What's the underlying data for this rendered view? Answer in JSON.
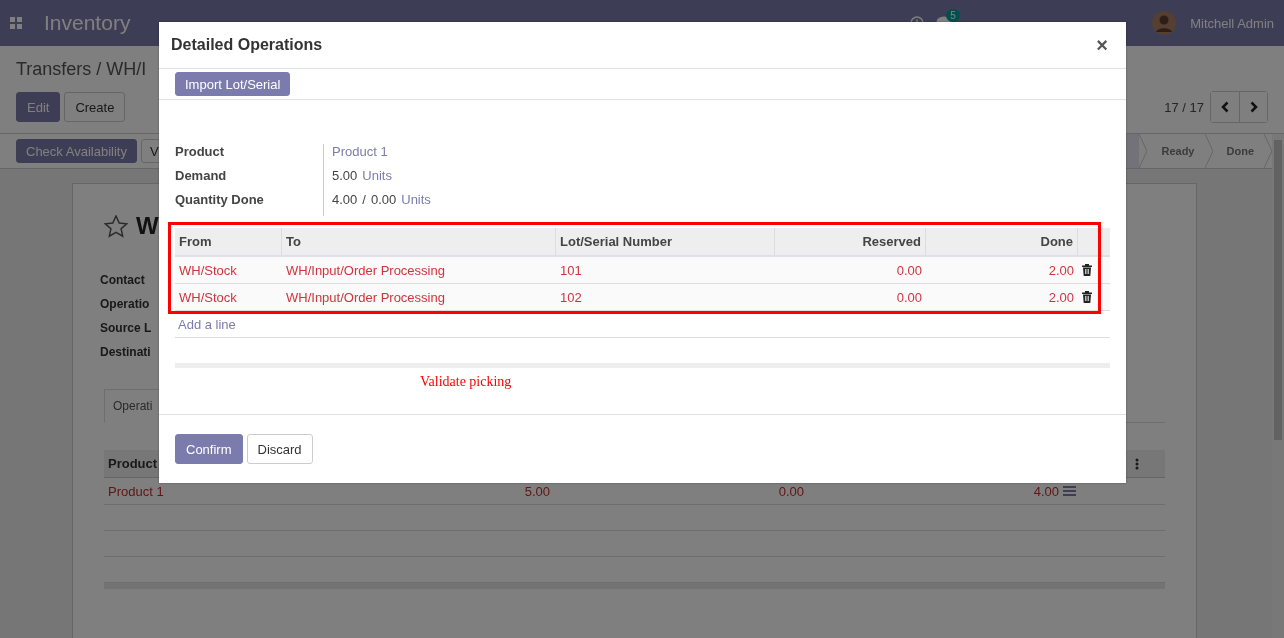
{
  "navbar": {
    "app_name": "Inventory",
    "notification_count": "5",
    "user": "Mitchell Admin"
  },
  "control_panel": {
    "breadcrumb": "Transfers / WH/I",
    "buttons": [
      {
        "label": "Edit",
        "kind": "primary"
      },
      {
        "label": "Create",
        "kind": "secondary"
      }
    ],
    "pager": "17 / 17"
  },
  "status_bar": {
    "buttons": [
      {
        "label": "Check Availability",
        "kind": "primary"
      },
      {
        "label": "V",
        "kind": "secondary"
      }
    ],
    "stages": [
      {
        "selected": true
      },
      {
        "label": "Ready",
        "selected": false
      },
      {
        "label": "Done",
        "selected": false
      }
    ]
  },
  "form": {
    "title": "W",
    "fields": [
      "Contact",
      "Operatio",
      "Source L",
      "Destinati"
    ],
    "tabs": [
      {
        "label": "Operati",
        "selected": true
      }
    ],
    "table": {
      "columns": [
        "Product"
      ],
      "rows": [
        {
          "product": "Product 1",
          "column_2": "5.00",
          "column_3": "0.00",
          "column_4": "4.00"
        }
      ]
    }
  },
  "dialog": {
    "title": "Detailed Operations",
    "close": "×",
    "header_button": "Import Lot/Serial",
    "fields": [
      {
        "label": "Product",
        "parts": [
          {
            "text": "Product 1",
            "kind": "link"
          }
        ]
      },
      {
        "label": "Demand",
        "parts": [
          {
            "text": "5.00",
            "kind": "plain"
          },
          {
            "text": "Units",
            "kind": "link"
          }
        ]
      },
      {
        "label": "Quantity Done",
        "parts": [
          {
            "text": "4.00",
            "kind": "plain"
          },
          {
            "text": "/",
            "kind": "plain"
          },
          {
            "text": "0.00",
            "kind": "plain"
          },
          {
            "text": "Units",
            "kind": "link"
          }
        ]
      }
    ],
    "table": {
      "columns": [
        {
          "label": "From",
          "numeric": false
        },
        {
          "label": "To",
          "numeric": false
        },
        {
          "label": "Lot/Serial Number",
          "numeric": false
        },
        {
          "label": "Reserved",
          "numeric": true
        },
        {
          "label": "Done",
          "numeric": true
        }
      ],
      "rows": [
        {
          "from": "WH/Stock",
          "to": "WH/Input/Order Processing",
          "lot": "101",
          "reserved": "0.00",
          "done": "2.00"
        },
        {
          "from": "WH/Stock",
          "to": "WH/Input/Order Processing",
          "lot": "102",
          "reserved": "0.00",
          "done": "2.00"
        }
      ],
      "add_line": "Add a line"
    },
    "annotation": "Validate picking",
    "buttons": [
      {
        "label": "Confirm",
        "kind": "primary"
      },
      {
        "label": "Discard",
        "kind": "secondary"
      }
    ]
  }
}
